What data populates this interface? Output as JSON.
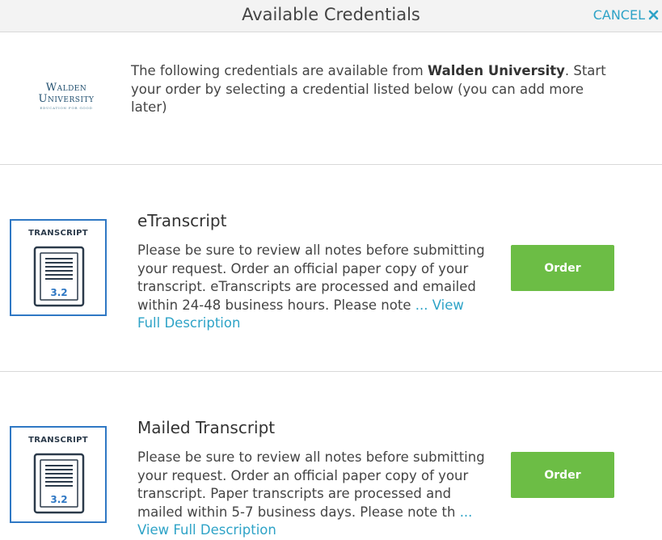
{
  "header": {
    "title": "Available Credentials",
    "cancel_label": "CANCEL"
  },
  "intro": {
    "logo": {
      "line1": "Walden",
      "line2": "University",
      "tagline": "EDUCATION FOR GOOD"
    },
    "text_before": "The following credentials are available from ",
    "institution": "Walden University",
    "text_after": ". Start your order by selecting a credential listed below (you can add more later)"
  },
  "credentials": [
    {
      "title": "eTranscript",
      "thumbnail_label": "TRANSCRIPT",
      "thumbnail_value": "3.2",
      "description": "Please be sure to review all notes before submitting your request. Order an official paper copy of your transcript. eTranscripts are processed and emailed within 24-48 business hours. Please note ",
      "link_label": "... View Full Description",
      "order_label": "Order"
    },
    {
      "title": "Mailed Transcript",
      "thumbnail_label": "TRANSCRIPT",
      "thumbnail_value": "3.2",
      "description": "Please be sure to review all notes before submitting your request. Order an official paper copy of your transcript. Paper transcripts are processed and mailed within 5-7 business days. Please note th ",
      "link_label": "... View Full Description",
      "order_label": "Order"
    }
  ],
  "colors": {
    "accent": "#2ea3c7",
    "order_button": "#6cbd45",
    "thumbnail_border": "#2f78c4",
    "header_bg": "#f3f3f3"
  }
}
